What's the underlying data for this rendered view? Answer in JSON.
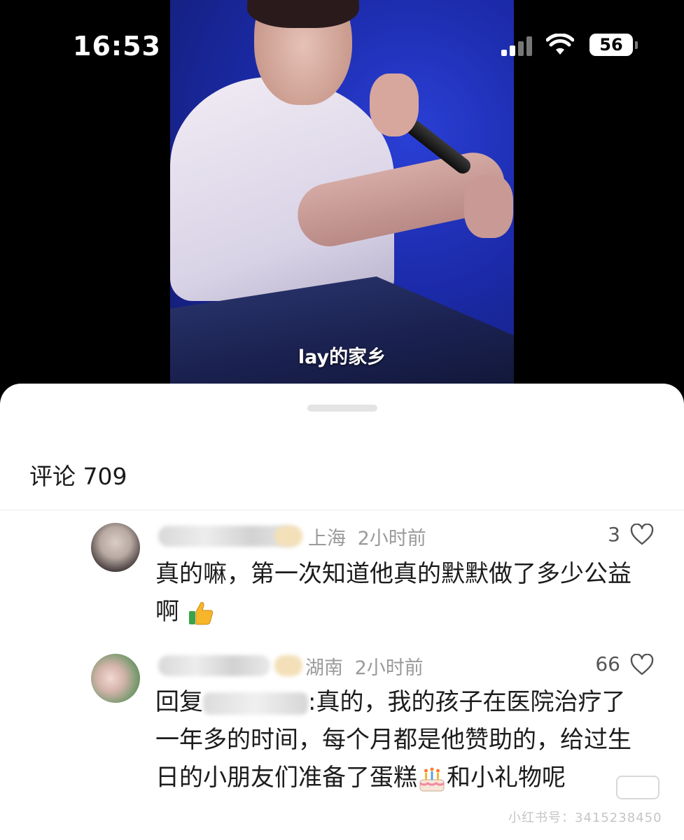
{
  "status_bar": {
    "time": "16:53",
    "battery": "56"
  },
  "video": {
    "subtitle": "lay的家乡"
  },
  "comments_panel": {
    "header": "评论 709",
    "comments": [
      {
        "location": "上海",
        "time_ago": "2小时前",
        "likes": "3",
        "text": "真的嘛，第一次知道他真的默默做了多少公益啊",
        "emoji": "thumbs-up-icon"
      },
      {
        "location": "湖南",
        "time_ago": "2小时前",
        "likes": "66",
        "reply_prefix": "回复",
        "text": ":真的，我的孩子在医院治疗了一年多的时间，每个月都是他赞助的，给过生日的小朋友们准备了蛋糕",
        "text_after_emoji": "和小礼物呢",
        "emoji": "birthday-cake-icon"
      }
    ]
  },
  "watermark": "小红书号：3415238450",
  "colors": {
    "meta_gray": "#9a9a9a",
    "text_dark": "#1c1c1c",
    "video_blue": "#1b2aa8"
  }
}
